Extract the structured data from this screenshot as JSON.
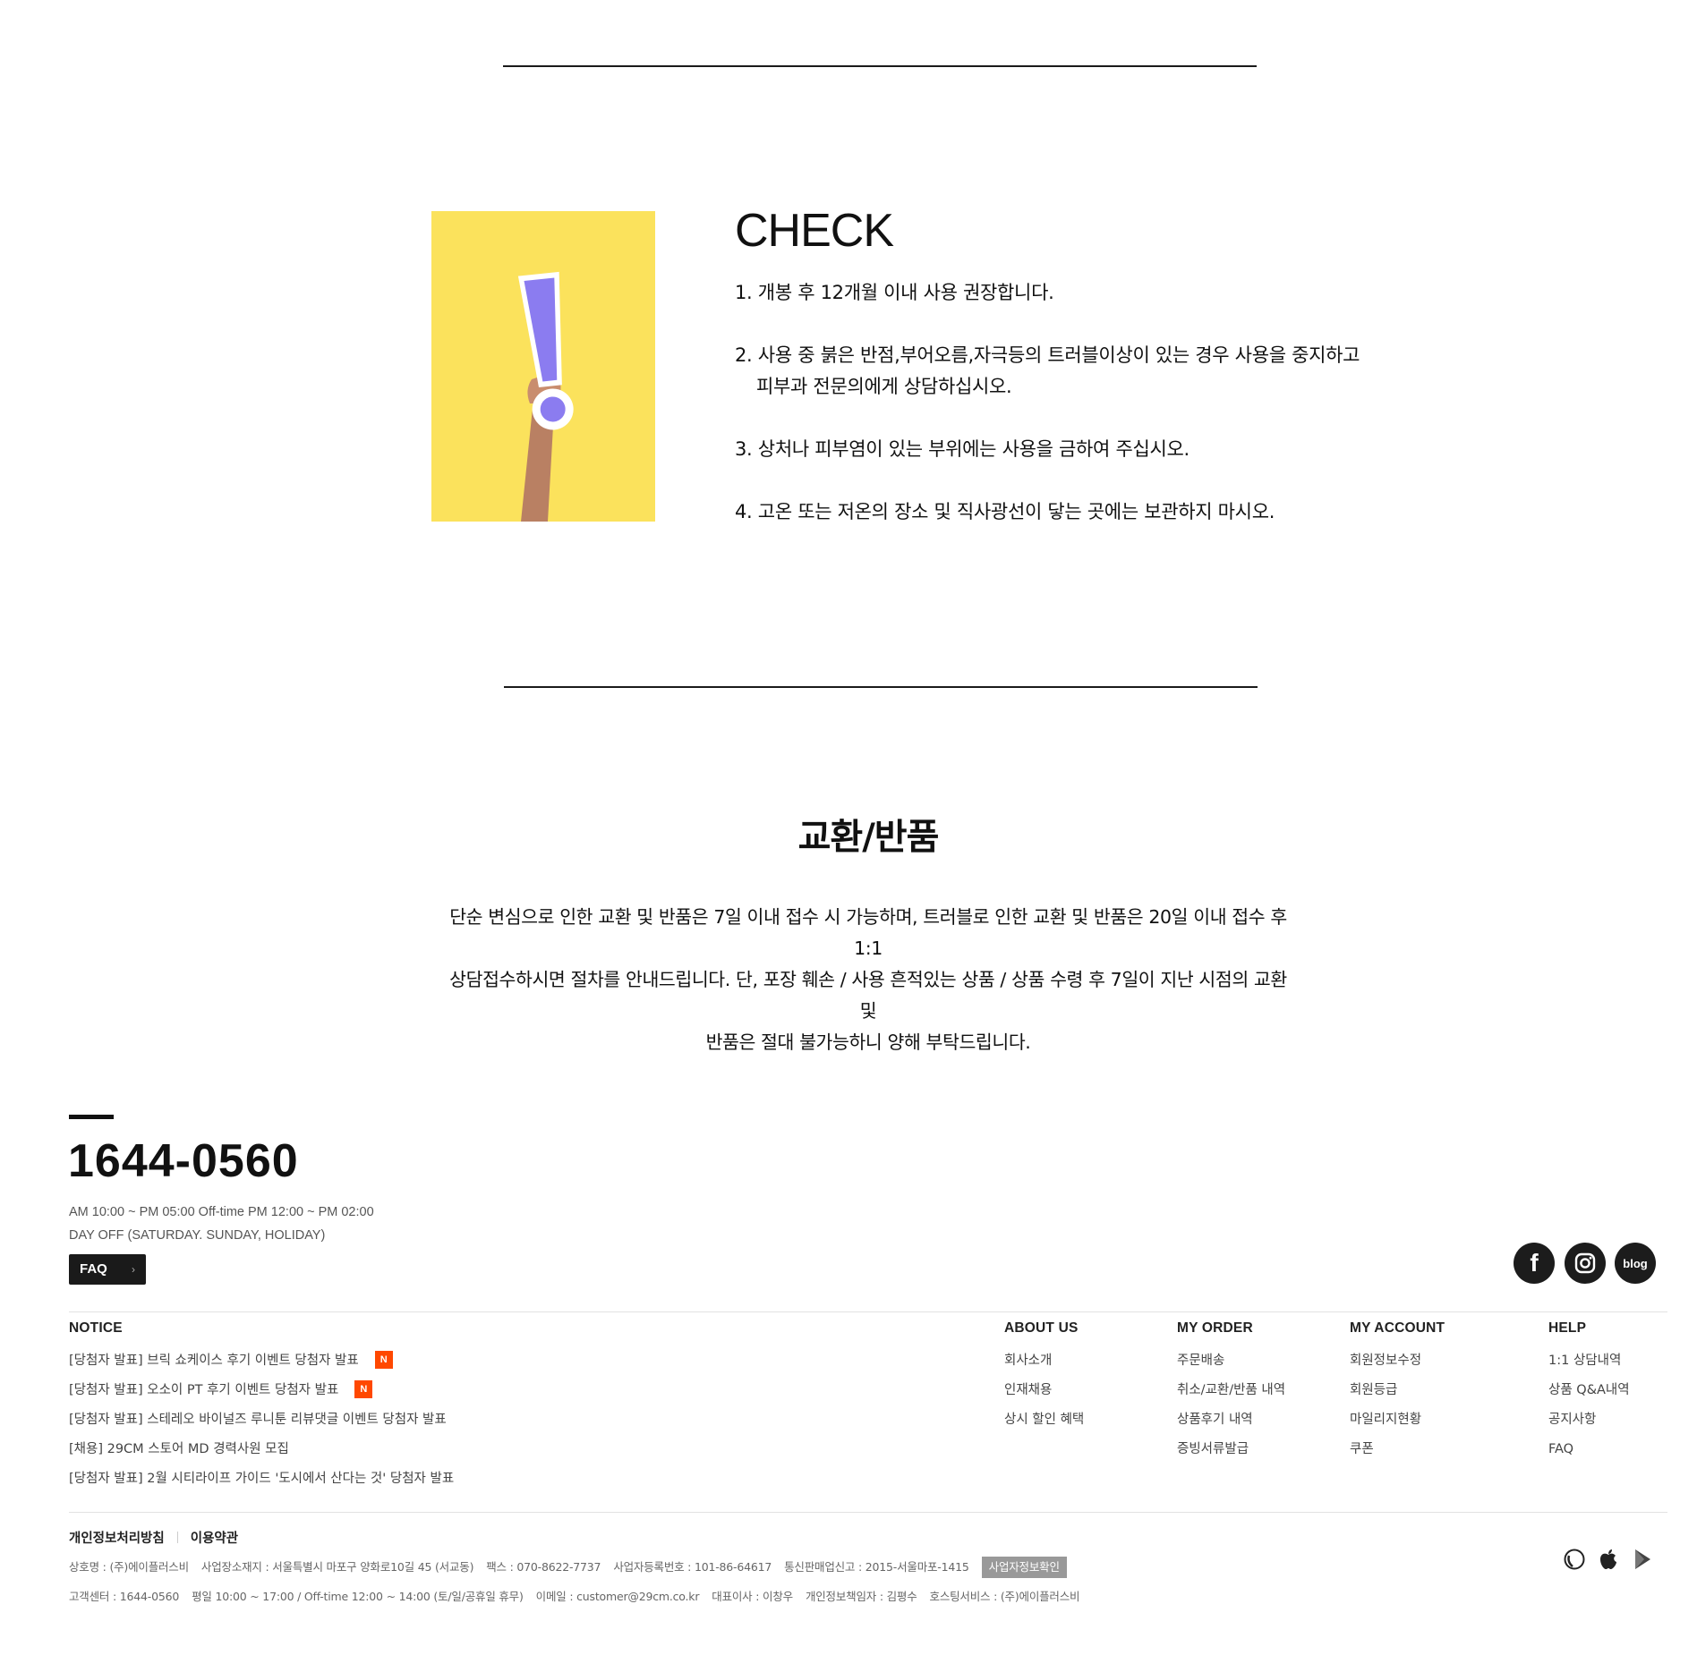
{
  "check": {
    "title": "CHECK",
    "items": [
      {
        "line1": "1. 개봉 후 12개월 이내 사용 권장합니다.",
        "line2": ""
      },
      {
        "line1": "2. 사용 중 붉은 반점,부어오름,자극등의 트러블이상이 있는 경우 사용을 중지하고",
        "line2": "피부과 전문의에게 상담하십시오."
      },
      {
        "line1": "3. 상처나 피부염이 있는 부위에는 사용을 금하여 주십시오.",
        "line2": ""
      },
      {
        "line1": "4. 고온 또는 저온의 장소 및 직사광선이 닿는 곳에는 보관하지 마시오.",
        "line2": ""
      }
    ]
  },
  "exchange": {
    "title": "교환/반품",
    "lines": [
      "단순 변심으로 인한 교환 및 반품은 7일 이내 접수 시 가능하며, 트러블로 인한 교환 및 반품은 20일 이내 접수 후 1:1",
      "상담접수하시면 절차를 안내드립니다. 단, 포장 훼손 / 사용 흔적있는 상품 / 상품 수령 후 7일이 지난 시점의 교환 및",
      "반품은 절대 불가능하니 양해 부탁드립니다."
    ]
  },
  "footer": {
    "phone": "1644-0560",
    "hours": "AM 10:00 ~ PM 05:00  Off-time PM 12:00 ~ PM 02:00",
    "dayoff": "DAY OFF (SATURDAY. SUNDAY, HOLIDAY)",
    "faq_label": "FAQ",
    "faq_chevron": "›",
    "social": {
      "facebook": "f",
      "blog": "blog"
    },
    "notice": {
      "title": "NOTICE",
      "badge": "N",
      "items": [
        "[당첨자 발표] 브릭 쇼케이스 후기 이벤트 당첨자 발표",
        "[당첨자 발표] 오소이 PT 후기 이벤트 당첨자 발표",
        "[당첨자 발표] 스테레오 바이널즈 루니툰 리뷰댓글 이벤트 당첨자 발표",
        "[채용] 29CM 스토어 MD 경력사원 모집",
        "[당첨자 발표] 2월 시티라이프 가이드 '도시에서 산다는 것' 당첨자 발표"
      ]
    },
    "columns": [
      {
        "title": "ABOUT US",
        "items": [
          "회사소개",
          "인재채용",
          "상시 할인 혜택"
        ]
      },
      {
        "title": "MY ORDER",
        "items": [
          "주문배송",
          "취소/교환/반품 내역",
          "상품후기 내역",
          "증빙서류발급"
        ]
      },
      {
        "title": "MY ACCOUNT",
        "items": [
          "회원정보수정",
          "회원등급",
          "마일리지현황",
          "쿠폰"
        ]
      },
      {
        "title": "HELP",
        "items": [
          "1:1 상담내역",
          "상품 Q&A내역",
          "공지사항",
          "FAQ"
        ]
      }
    ],
    "legal": {
      "privacy": "개인정보처리방침",
      "terms": "이용약관"
    },
    "info1": [
      "상호명 : (주)에이플러스비",
      "사업장소재지 : 서울특별시 마포구 양화로10길 45 (서교동)",
      "팩스 : 070-8622-7737",
      "사업자등록번호 : 101-86-64617",
      "통신판매업신고 : 2015-서울마포-1415"
    ],
    "biz_button": "사업자정보확인",
    "info2": [
      "고객센터 : 1644-0560",
      "평일 10:00 ~ 17:00 / Off-time 12:00 ~ 14:00 (토/일/공휴일 휴무)",
      "이메일 : customer@29cm.co.kr",
      "대표이사 : 이창우",
      "개인정보책임자 : 김평수",
      "호스팅서비스 : (주)에이플러스비"
    ]
  }
}
